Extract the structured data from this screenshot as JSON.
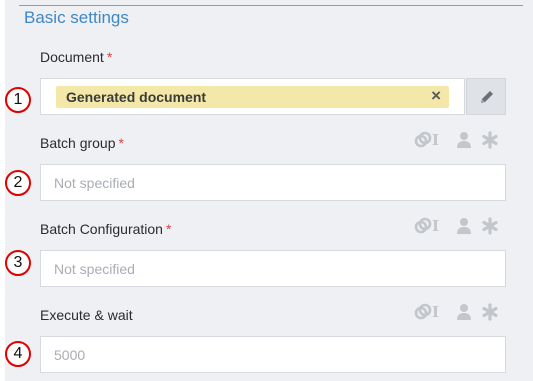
{
  "section": {
    "title": "Basic settings"
  },
  "fields": [
    {
      "badge": "1",
      "label": "Document",
      "required_mark": "*",
      "chip": {
        "label": "Generated document",
        "remove_glyph": "×"
      }
    },
    {
      "badge": "2",
      "label": "Batch group",
      "required_mark": "*",
      "placeholder": "Not specified"
    },
    {
      "badge": "3",
      "label": "Batch Configuration",
      "required_mark": "*",
      "placeholder": "Not specified"
    },
    {
      "badge": "4",
      "label": "Execute & wait",
      "placeholder": "5000"
    }
  ],
  "field_icons": {
    "cursor_glyph": "I"
  },
  "colors": {
    "section_title": "#3f88c5",
    "required": "#d64545",
    "chip_bg": "#f4e8a8",
    "badge_border": "#e00000",
    "icon": "#c3c6cb"
  }
}
